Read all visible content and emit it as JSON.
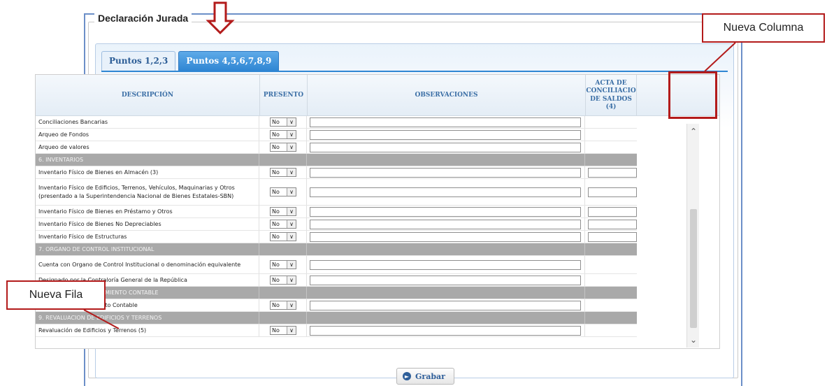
{
  "panel": {
    "title": "Declaración Jurada"
  },
  "tabs": [
    {
      "label": "Puntos 1,2,3",
      "active": false
    },
    {
      "label": "Puntos 4,5,6,7,8,9",
      "active": true
    }
  ],
  "columns": {
    "descripcion": "DESCRIPCIÓN",
    "presento": "PRESENTO",
    "observaciones": "OBSERVACIONES",
    "acta": "ACTA DE CONCILIACIO DE SALDOS (4)"
  },
  "rows": [
    {
      "type": "item",
      "label": "Conciliaciones Bancarias",
      "presento": "No",
      "acta": false,
      "lines": 1
    },
    {
      "type": "item",
      "label": "Arqueo de Fondos",
      "presento": "No",
      "acta": false,
      "lines": 1
    },
    {
      "type": "item",
      "label": "Arqueo de valores",
      "presento": "No",
      "acta": false,
      "lines": 1
    },
    {
      "type": "section",
      "label": "6. INVENTARIOS"
    },
    {
      "type": "item",
      "label": "Inventario Físico de Bienes en Almacén (3)",
      "presento": "No",
      "acta": true,
      "lines": 1
    },
    {
      "type": "item",
      "label": "Inventario Físico de Edificios, Terrenos, Vehículos, Maquinarias y Otros (presentado a la Superintendencia Nacional de Bienes Estatales-SBN)",
      "presento": "No",
      "acta": true,
      "lines": 3
    },
    {
      "type": "item",
      "label": "Inventario Físico de Bienes en Préstamo y Otros",
      "presento": "No",
      "acta": true,
      "lines": 1
    },
    {
      "type": "item",
      "label": "Inventario Físico de Bienes No Depreciables",
      "presento": "No",
      "acta": true,
      "lines": 1
    },
    {
      "type": "item",
      "label": "Inventario Físico de Estructuras",
      "presento": "No",
      "acta": true,
      "lines": 1
    },
    {
      "type": "section",
      "label": "7. ORGANO DE CONTROL INSTITUCIONAL"
    },
    {
      "type": "item",
      "label": "Cuenta con Organo de Control Institucional o denominación equivalente",
      "presento": "No",
      "acta": false,
      "lines": 2
    },
    {
      "type": "item",
      "label": "Designado por la Contraloría General de la República",
      "presento": "No",
      "acta": false,
      "lines": 1
    },
    {
      "type": "section",
      "label": "8. ACCIONES DE SANEAMIENTO CONTABLE"
    },
    {
      "type": "item",
      "label": "Acciones de Saneamiento Contable",
      "presento": "No",
      "acta": false,
      "lines": 1
    },
    {
      "type": "section",
      "label": "9. REVALUACION DE EDIFICIOS Y TERRENOS"
    },
    {
      "type": "item",
      "label": "Revaluación de Edificios y Terrenos (5)",
      "presento": "No",
      "acta": false,
      "lines": 1
    }
  ],
  "actions": {
    "save_label": "Grabar"
  },
  "annotations": {
    "new_column": "Nueva Columna",
    "new_row": "Nueva Fila"
  },
  "colors": {
    "accent": "#2f86d3",
    "annotation": "#b31b1b",
    "section": "#a9a9a9"
  }
}
